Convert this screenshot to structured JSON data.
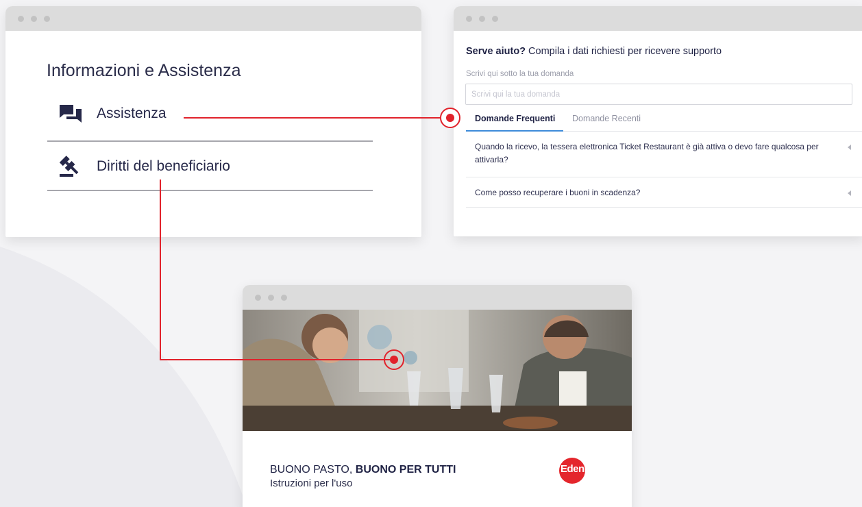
{
  "info_window": {
    "title": "Informazioni e Assistenza",
    "items": [
      {
        "label": "Assistenza",
        "icon": "chat-bubbles-icon"
      },
      {
        "label": "Diritti del beneficiario",
        "icon": "gavel-icon"
      }
    ]
  },
  "support_window": {
    "heading_bold": "Serve aiuto?",
    "heading_rest": " Compila i dati richiesti per ricevere supporto",
    "question_label": "Scrivi qui sotto la tua domanda",
    "question_placeholder": "Scrivi qui la tua domanda",
    "tabs": [
      {
        "label": "Domande Frequenti",
        "active": true
      },
      {
        "label": "Domande Recenti",
        "active": false
      }
    ],
    "faqs": [
      {
        "text": "Quando la ricevo, la tessera elettronica Ticket Restaurant è già attiva o devo fare qualcosa per attivarla?"
      },
      {
        "text": "Come posso recuperare i buoni in scadenza?"
      }
    ]
  },
  "guide_window": {
    "title_regular": "BUONO PASTO, ",
    "title_bold": "BUONO PER TUTTI",
    "subtitle": "Istruzioni per l'uso",
    "logo_text": "Edenred"
  },
  "colors": {
    "connector": "#e1222b",
    "accent_tab": "#3d8bd9",
    "brand_red": "#e4262c",
    "navy": "#1f2244"
  }
}
